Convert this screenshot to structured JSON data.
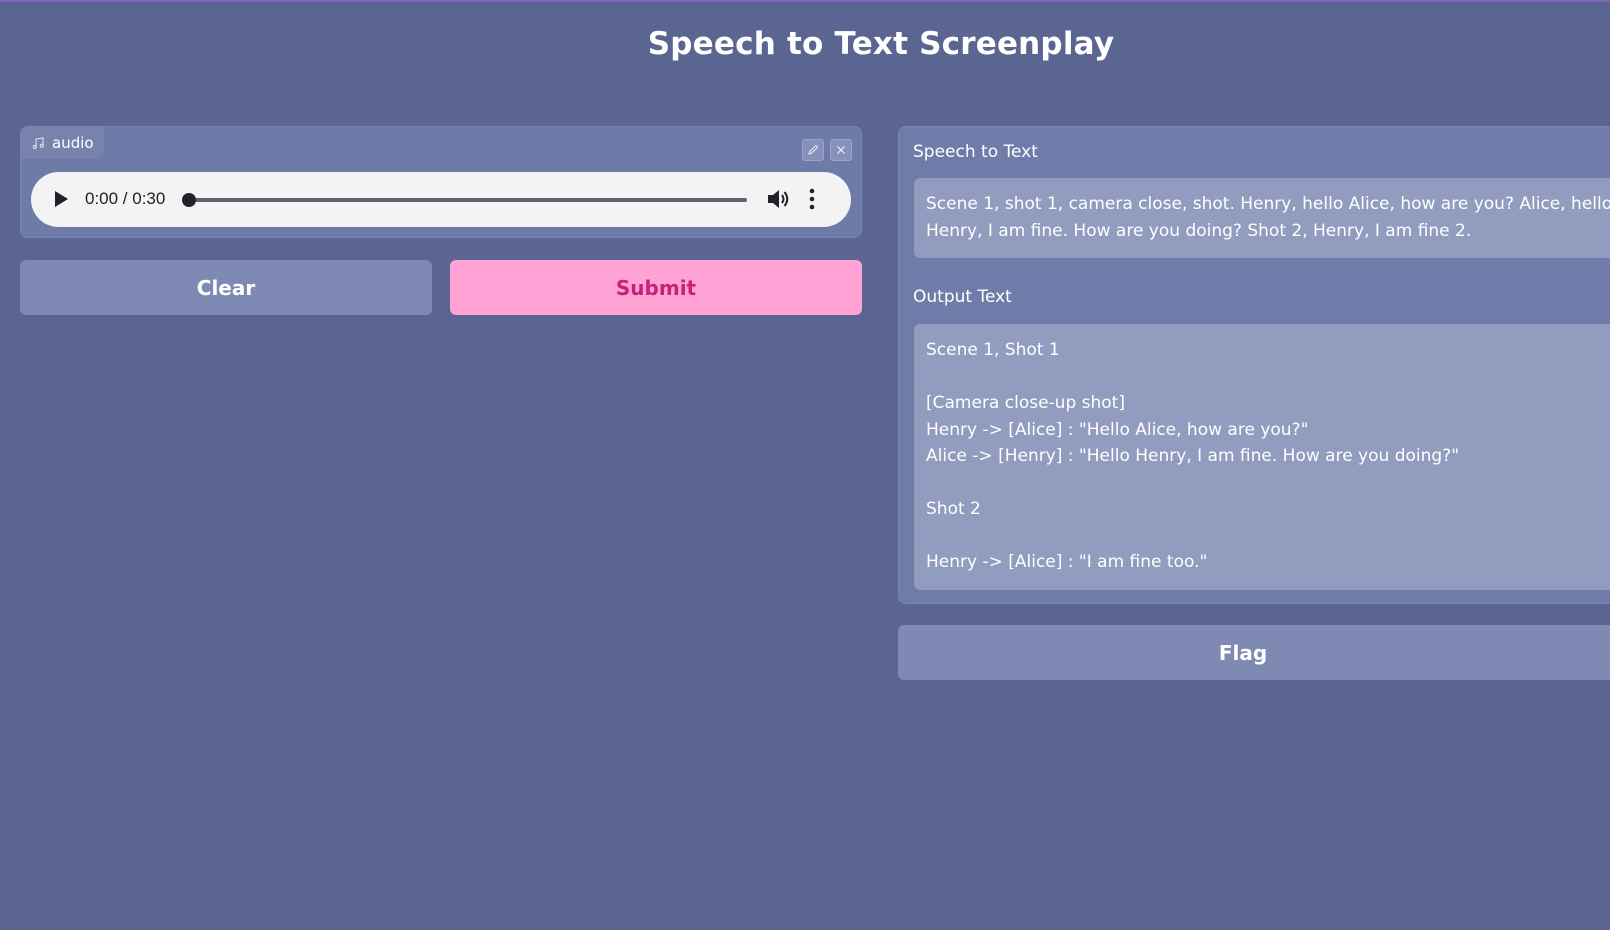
{
  "app": {
    "title": "Speech to Text Screenplay"
  },
  "audio_input": {
    "label": "audio",
    "label_icon": "music-note-icon",
    "edit_icon": "pencil-icon",
    "close_icon": "close-icon",
    "player": {
      "time": "0:00 / 0:30",
      "progress": 0,
      "play_icon": "play-icon",
      "volume_icon": "volume-icon",
      "more_icon": "more-vertical-icon"
    }
  },
  "actions": {
    "clear_label": "Clear",
    "submit_label": "Submit",
    "flag_label": "Flag"
  },
  "speech_to_text": {
    "label": "Speech to Text",
    "value": "Scene 1, shot 1, camera close, shot. Henry, hello Alice, how are you? Alice, hello Henry, I am fine. How are you doing? Shot 2, Henry, I am fine 2."
  },
  "output_text": {
    "label": "Output Text",
    "value": "Scene 1, Shot 1\n\n[Camera close-up shot]\nHenry -> [Alice] : \"Hello Alice, how are you?\"\nAlice -> [Henry] : \"Hello Henry, I am fine. How are you doing?\"\n\nShot 2\n\nHenry -> [Alice] : \"I am fine too.\""
  },
  "colors": {
    "background": "#5a6691",
    "panel": "#6f7ca9",
    "textbox": "#929cbf",
    "secondary_button": "#7e8ab3",
    "primary_button": "#ffa2d5",
    "primary_button_text": "#c8217a"
  }
}
